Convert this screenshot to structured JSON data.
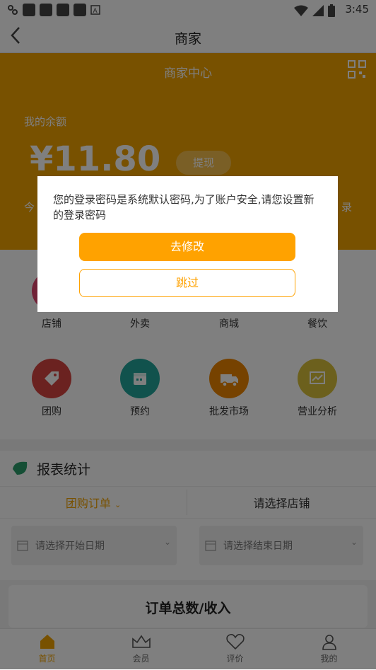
{
  "status_bar": {
    "time": "3:45"
  },
  "nav_bar": {
    "title": "商家"
  },
  "header": {
    "title": "商家中心",
    "balance_label": "我的余额",
    "balance_amount": "¥11.80",
    "withdraw_label": "提现",
    "today_left_partial": "今",
    "today_right_partial": "录"
  },
  "menu": {
    "items": [
      {
        "label": "店铺",
        "icon": "store-icon",
        "color": "#e0456f"
      },
      {
        "label": "外卖",
        "icon": "takeout-icon",
        "color": "#f1a200"
      },
      {
        "label": "商城",
        "icon": "mall-icon",
        "color": "#2ba8a0"
      },
      {
        "label": "餐饮",
        "icon": "restaurant-icon",
        "color": "#e86b2c"
      },
      {
        "label": "团购",
        "icon": "tag-icon",
        "color": "#d64541"
      },
      {
        "label": "预约",
        "icon": "calendar-icon",
        "color": "#22a59a"
      },
      {
        "label": "批发市场",
        "icon": "truck-icon",
        "color": "#ec8500"
      },
      {
        "label": "营业分析",
        "icon": "chart-icon",
        "color": "#d9c13a"
      }
    ]
  },
  "report": {
    "title": "报表统计",
    "tab_group_order": "团购订单",
    "tab_select_store": "请选择店铺",
    "start_date_placeholder": "请选择开始日期",
    "end_date_placeholder": "请选择结束日期",
    "summary_title": "订单总数/收入"
  },
  "bottom_nav": {
    "items": [
      {
        "label": "首页",
        "icon": "home-icon",
        "active": true
      },
      {
        "label": "会员",
        "icon": "crown-icon",
        "active": false
      },
      {
        "label": "评价",
        "icon": "heart-icon",
        "active": false
      },
      {
        "label": "我的",
        "icon": "user-icon",
        "active": false
      }
    ]
  },
  "dialog": {
    "message": "您的登录密码是系统默认密码,为了账户安全,请您设置新的登录密码",
    "primary_button": "去修改",
    "secondary_button": "跳过"
  },
  "colors": {
    "accent": "#ffa200",
    "header": "#f1a200"
  }
}
